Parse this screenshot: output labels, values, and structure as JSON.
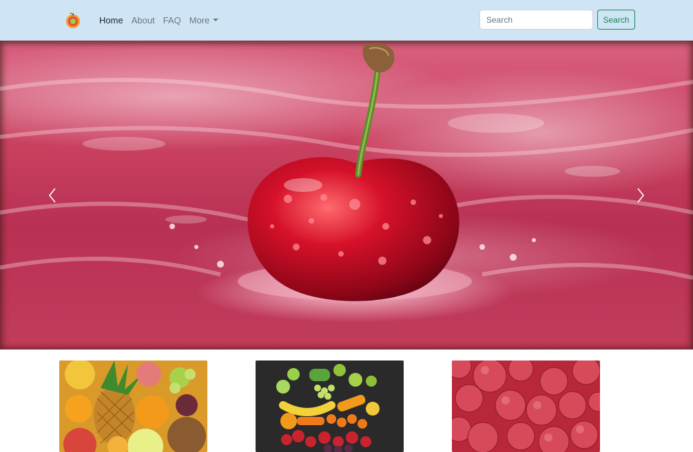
{
  "navbar": {
    "brand_icon": "fruit-logo-icon",
    "links": [
      {
        "label": "Home",
        "active": true
      },
      {
        "label": "About",
        "active": false
      },
      {
        "label": "FAQ",
        "active": false
      },
      {
        "label": "More",
        "active": false,
        "dropdown": true
      }
    ],
    "search": {
      "placeholder": "Search",
      "value": ""
    },
    "search_button": "Search",
    "colors": {
      "background": "#cfe5f5",
      "button_accent": "#198754"
    }
  },
  "carousel": {
    "slide_image": "cherry-splash-image",
    "prev_icon": "chevron-left-icon",
    "next_icon": "chevron-right-icon",
    "accent": "#c23c5c"
  },
  "cards": [
    {
      "image": "mixed-fruit-pineapple-image"
    },
    {
      "image": "fruit-vegetable-rainbow-image"
    },
    {
      "image": "pomegranates-image"
    }
  ]
}
